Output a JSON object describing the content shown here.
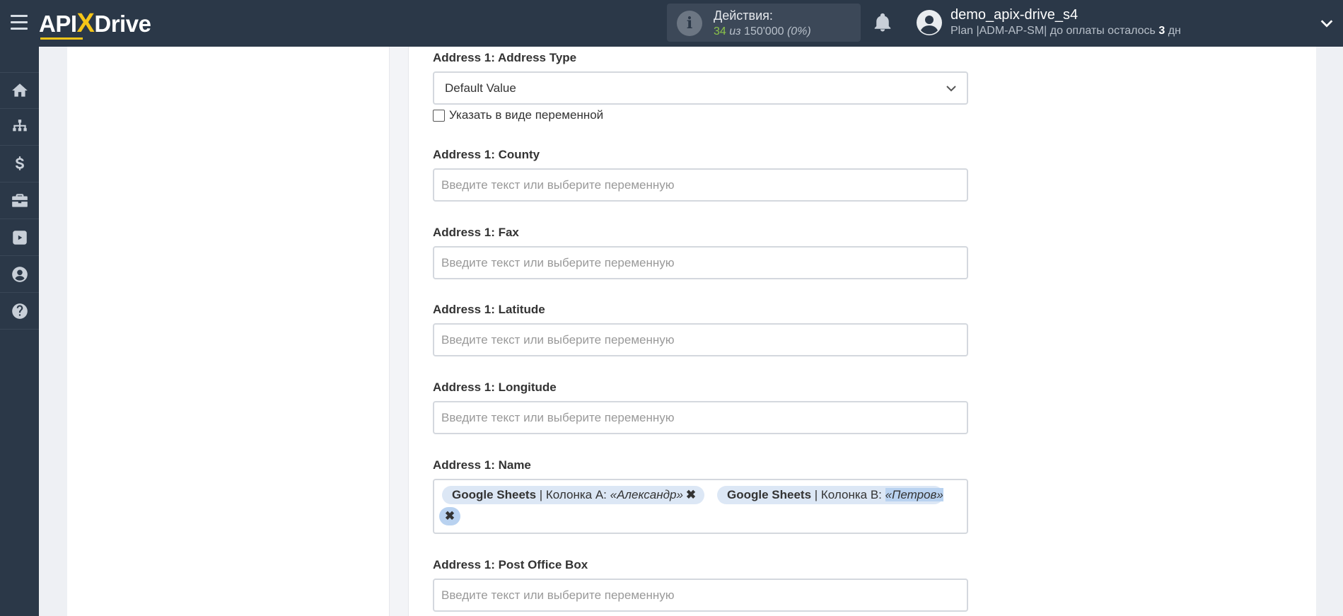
{
  "app": {
    "logo_left": "API",
    "logo_x": "X",
    "logo_right": "Drive"
  },
  "actions": {
    "label": "Действия:",
    "used": "34",
    "of": "из",
    "total": "150'000",
    "percent": "(0%)"
  },
  "user": {
    "name": "demo_apix-drive_s4",
    "plan_prefix": "Plan |ADM-AP-SM| до оплаты осталось",
    "days": "3",
    "days_suffix": "дн"
  },
  "sidebar": {
    "items": [
      {
        "icon": "home-icon"
      },
      {
        "icon": "sitemap-icon"
      },
      {
        "icon": "dollar-icon"
      },
      {
        "icon": "briefcase-icon"
      },
      {
        "icon": "youtube-icon"
      },
      {
        "icon": "user-circle-icon"
      },
      {
        "icon": "question-icon"
      }
    ]
  },
  "form": {
    "address_type": {
      "label": "Address 1: Address Type",
      "value": "Default Value",
      "checkbox_label": "Указать в виде переменной"
    },
    "county": {
      "label": "Address 1: County",
      "placeholder": "Введите текст или выберите переменную"
    },
    "fax": {
      "label": "Address 1: Fax",
      "placeholder": "Введите текст или выберите переменную"
    },
    "latitude": {
      "label": "Address 1: Latitude",
      "placeholder": "Введите текст или выберите переменную"
    },
    "longitude": {
      "label": "Address 1: Longitude",
      "placeholder": "Введите текст или выберите переменную"
    },
    "name": {
      "label": "Address 1: Name",
      "tags": [
        {
          "source": "Google Sheets",
          "column": " | Колонка A: ",
          "value": "«Александр»",
          "remove": "✖"
        },
        {
          "source": "Google Sheets",
          "column": " | Колонка B: ",
          "value": "«Петров»",
          "remove": "✖"
        }
      ]
    },
    "post_office_box": {
      "label": "Address 1: Post Office Box",
      "placeholder": "Введите текст или выберите переменную"
    }
  }
}
